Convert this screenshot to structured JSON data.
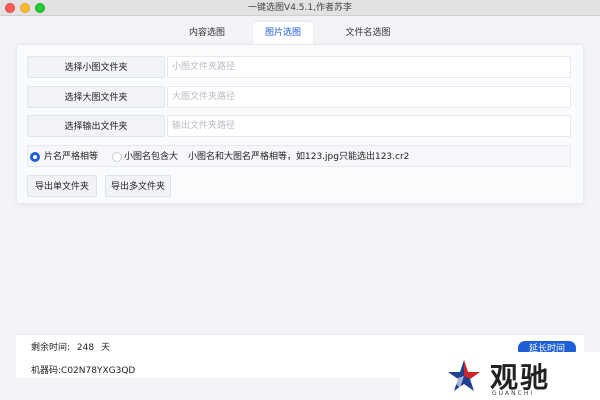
{
  "window": {
    "title": "一键选图V4.5.1,作者苏李"
  },
  "tabs": [
    {
      "label": "内容选图",
      "active": false
    },
    {
      "label": "图片选图",
      "active": true
    },
    {
      "label": "文件名选图",
      "active": false
    }
  ],
  "paths": {
    "small": {
      "button": "选择小图文件夹",
      "placeholder": "小图文件夹路径",
      "value": ""
    },
    "large": {
      "button": "选择大图文件夹",
      "placeholder": "大图文件夹路径",
      "value": ""
    },
    "output": {
      "button": "选择输出文件夹",
      "placeholder": "输出文件夹路径",
      "value": ""
    }
  },
  "mode": {
    "option_strict": "片名严格相等",
    "option_contains": "小图名包含大",
    "selected": "option_strict",
    "hint": "小图名和大图名严格相等，如123.jpg只能选出123.cr2"
  },
  "export": {
    "single": "导出单文件夹",
    "multi": "导出多文件夹"
  },
  "footer": {
    "remaining_label": "剩余时间:",
    "remaining_value": "248",
    "remaining_unit": "天",
    "machine_code": "机器码:C02N78YXG3QD",
    "extend_button": "延长时间"
  },
  "watermark": {
    "text": "观驰",
    "subtext": "GUANCHI"
  },
  "colors": {
    "accent": "#1f5fd6",
    "close": "#ff5f57",
    "minimize": "#febc2e",
    "maximize": "#28c840"
  }
}
